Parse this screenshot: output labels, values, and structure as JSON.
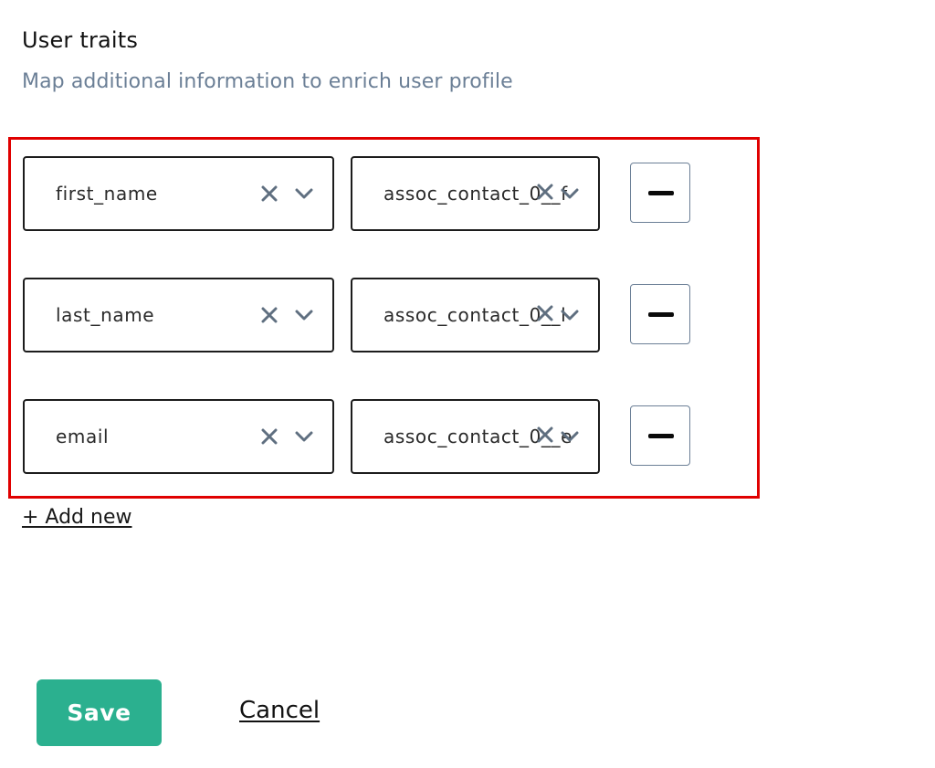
{
  "section": {
    "title": "User traits",
    "subtitle": "Map additional information to enrich user profile"
  },
  "mappings": [
    {
      "trait": "first_name",
      "source": "assoc_contact_0__f"
    },
    {
      "trait": "last_name",
      "source": "assoc_contact_0__l"
    },
    {
      "trait": "email",
      "source": "assoc_contact_0__e"
    }
  ],
  "icons": {
    "clear": "close-icon",
    "dropdown": "chevron-down-icon",
    "remove": "minus-icon"
  },
  "actions": {
    "add_new": "+ Add new",
    "save": "Save",
    "cancel": "Cancel"
  },
  "colors": {
    "highlight_border": "#e00000",
    "subtitle": "#6b7f96",
    "save_button": "#2bb08f",
    "icon": "#5f6f80"
  }
}
